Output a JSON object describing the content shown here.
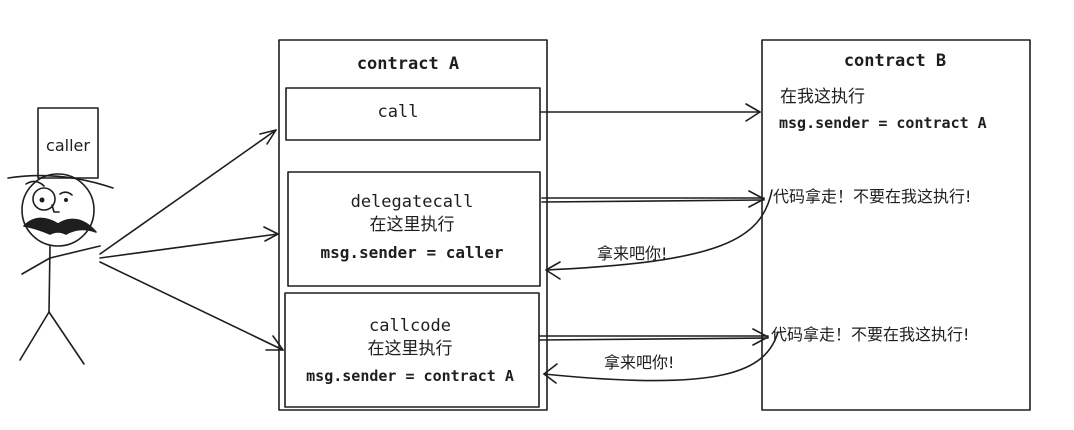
{
  "caller": {
    "hat_label": "caller"
  },
  "contract_a": {
    "title": "contract A",
    "call_box": {
      "label": "call"
    },
    "delegatecall_box": {
      "label": "delegatecall",
      "note": "在这里执行",
      "sender": "msg.sender = caller"
    },
    "callcode_box": {
      "label": "callcode",
      "note": "在这里执行",
      "sender": "msg.sender = contract A"
    }
  },
  "contract_b": {
    "title": "contract B",
    "call_note": "在我这执行",
    "call_sender": "msg.sender = contract A",
    "delegatecall_reply": "代码拿走！不要在我这执行!",
    "callcode_reply": "代码拿走！不要在我这执行!"
  },
  "return_labels": {
    "delegatecall": "拿来吧你!",
    "callcode": "拿来吧你!"
  }
}
